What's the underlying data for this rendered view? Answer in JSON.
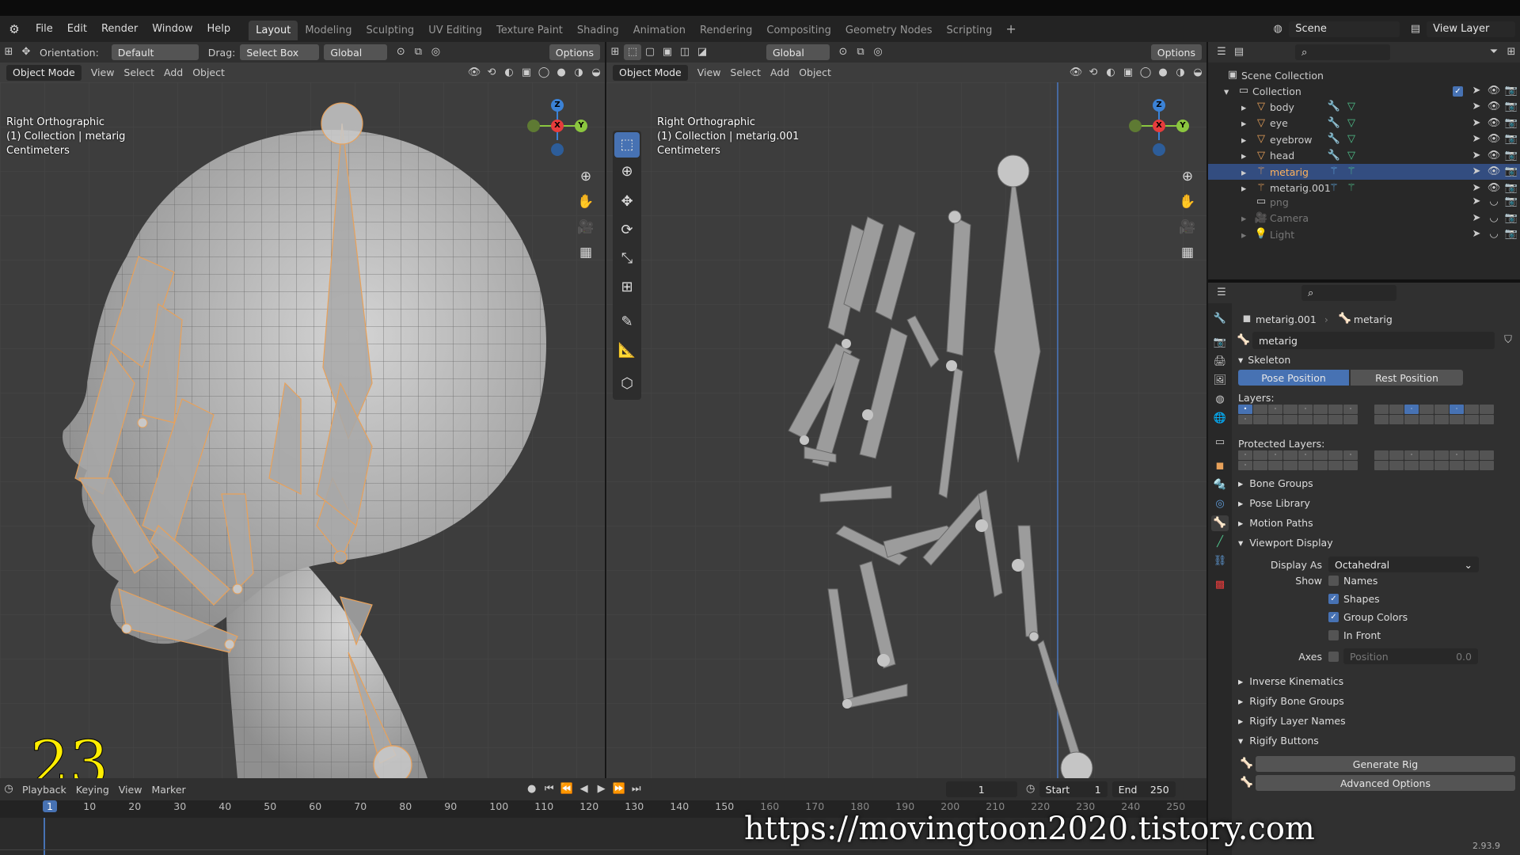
{
  "topbar": {
    "menus": [
      "File",
      "Edit",
      "Render",
      "Window",
      "Help"
    ],
    "workspaces": [
      "Layout",
      "Modeling",
      "Sculpting",
      "UV Editing",
      "Texture Paint",
      "Shading",
      "Animation",
      "Rendering",
      "Compositing",
      "Geometry Nodes",
      "Scripting"
    ],
    "active_workspace": "Layout",
    "scene": "Scene",
    "view_layer": "View Layer"
  },
  "left_viewport": {
    "orientation_label": "Orientation:",
    "orientation_value": "Default",
    "drag_label": "Drag:",
    "drag_value": "Select Box",
    "transform_orientation": "Global",
    "options": "Options",
    "mode": "Object Mode",
    "menus": [
      "View",
      "Select",
      "Add",
      "Object"
    ],
    "overlay_lines": [
      "Right Orthographic",
      "(1) Collection | metarig",
      "Centimeters"
    ]
  },
  "right_viewport": {
    "transform_orientation": "Global",
    "options": "Options",
    "mode": "Object Mode",
    "menus": [
      "View",
      "Select",
      "Add",
      "Object"
    ],
    "overlay_lines": [
      "Right Orthographic",
      "(1) Collection | metarig.001",
      "Centimeters"
    ]
  },
  "gizmo": {
    "z": "Z",
    "x": "X",
    "y": "Y"
  },
  "outliner": {
    "root": "Scene Collection",
    "collection": "Collection",
    "items": [
      {
        "name": "body",
        "selected": false
      },
      {
        "name": "eye",
        "selected": false
      },
      {
        "name": "eyebrow",
        "selected": false
      },
      {
        "name": "head",
        "selected": false
      },
      {
        "name": "metarig",
        "selected": true
      },
      {
        "name": "metarig.001",
        "selected": false
      }
    ],
    "hidden_items": [
      "png",
      "Camera",
      "Light"
    ]
  },
  "properties": {
    "breadcrumb_object": "metarig.001",
    "breadcrumb_data": "metarig",
    "data_name": "metarig",
    "skeleton_label": "Skeleton",
    "pose_position": "Pose Position",
    "rest_position": "Rest Position",
    "layers_label": "Layers:",
    "protected_layers_label": "Protected Layers:",
    "collapsed_sections_a": [
      "Bone Groups",
      "Pose Library",
      "Motion Paths"
    ],
    "viewport_display": "Viewport Display",
    "display_as_label": "Display As",
    "display_as_value": "Octahedral",
    "show_label": "Show",
    "show_options": [
      {
        "label": "Names",
        "checked": false
      },
      {
        "label": "Shapes",
        "checked": true
      },
      {
        "label": "Group Colors",
        "checked": true
      },
      {
        "label": "In Front",
        "checked": false
      }
    ],
    "axes_label": "Axes",
    "axes_position_label": "Position",
    "axes_position_value": "0.0",
    "collapsed_sections_b": [
      "Inverse Kinematics",
      "Rigify Bone Groups",
      "Rigify Layer Names"
    ],
    "rigify_buttons": "Rigify Buttons",
    "generate_rig": "Generate Rig",
    "advanced_options": "Advanced Options",
    "version": "2.93.9"
  },
  "timeline": {
    "playback": "Playback",
    "keying": "Keying",
    "menus": [
      "View",
      "Marker"
    ],
    "current_frame": "1",
    "start_label": "Start",
    "start_value": "1",
    "end_label": "End",
    "end_value": "250",
    "ticks": [
      "1",
      "10",
      "20",
      "30",
      "40",
      "50",
      "60",
      "70",
      "80",
      "90",
      "100",
      "110",
      "120",
      "130",
      "140",
      "150",
      "160",
      "170",
      "180",
      "190",
      "200",
      "210",
      "220",
      "230",
      "240",
      "250"
    ]
  },
  "overlay_number": "23",
  "watermark": "https://movingtoon2020.tistory.com",
  "colors": {
    "accent": "#4772b3",
    "selection_orange": "#e8a15a",
    "x_axis": "#e63c3c",
    "y_axis": "#8bc63f",
    "z_axis": "#3b82d6"
  }
}
